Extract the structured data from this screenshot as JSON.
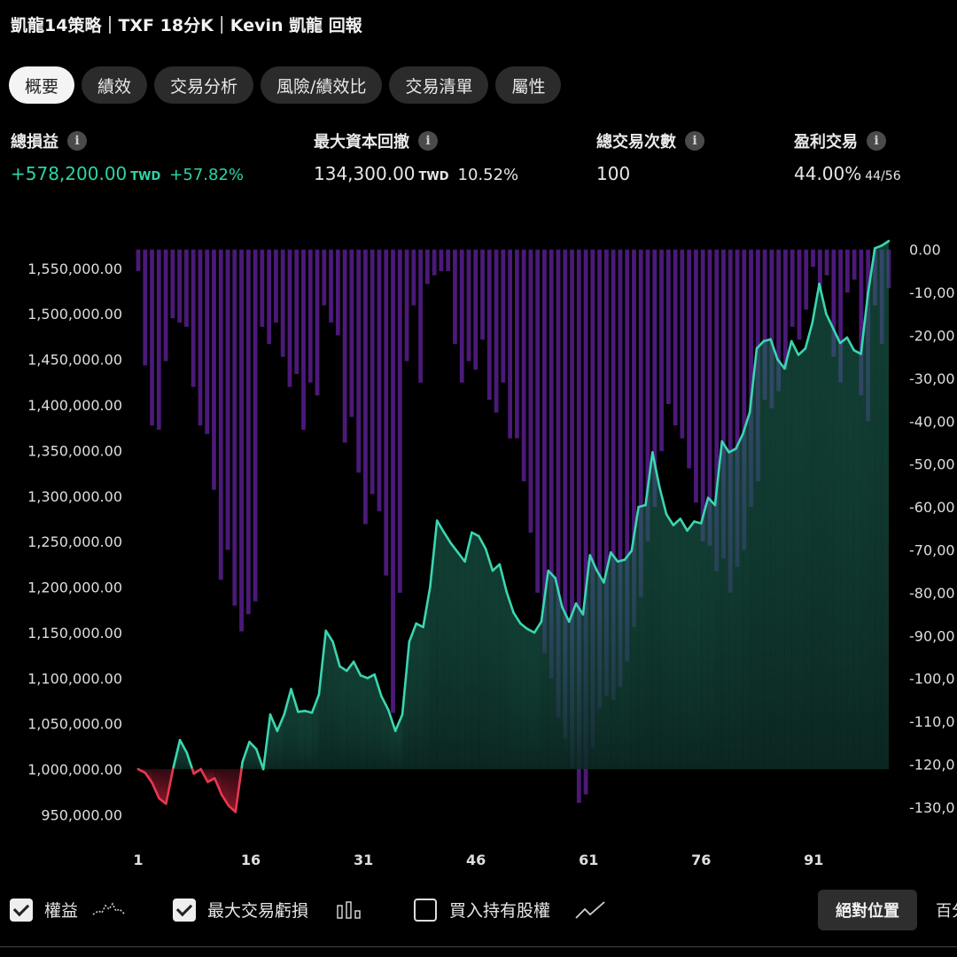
{
  "header": {
    "title": "凱龍14策略｜TXF 18分K｜Kevin 凱龍 回報"
  },
  "tabs": [
    {
      "label": "概要",
      "active": true
    },
    {
      "label": "績效"
    },
    {
      "label": "交易分析"
    },
    {
      "label": "風險/績效比"
    },
    {
      "label": "交易清單"
    },
    {
      "label": "屬性"
    }
  ],
  "stats": {
    "net_profit": {
      "label": "總損益",
      "value": "+578,200.00",
      "unit": "TWD",
      "pct": "+57.82%"
    },
    "max_drawdown": {
      "label": "最大資本回撤",
      "value": "134,300.00",
      "unit": "TWD",
      "pct": "10.52%"
    },
    "total_trades": {
      "label": "總交易次數",
      "value": "100"
    },
    "win_trades": {
      "label": "盈利交易",
      "value": "44.00%",
      "ratio": "44/56"
    }
  },
  "chart_data": {
    "type": "line",
    "x": [
      1,
      2,
      3,
      4,
      5,
      6,
      7,
      8,
      9,
      10,
      11,
      12,
      13,
      14,
      15,
      16,
      17,
      18,
      19,
      20,
      21,
      22,
      23,
      24,
      25,
      26,
      27,
      28,
      29,
      30,
      31,
      32,
      33,
      34,
      35,
      36,
      37,
      38,
      39,
      40,
      41,
      42,
      43,
      44,
      45,
      46,
      47,
      48,
      49,
      50,
      51,
      52,
      53,
      54,
      55,
      56,
      57,
      58,
      59,
      60,
      61,
      62,
      63,
      64,
      65,
      66,
      67,
      68,
      69,
      70,
      71,
      72,
      73,
      74,
      75,
      76,
      77,
      78,
      79,
      80,
      81,
      82,
      83,
      84,
      85,
      86,
      87,
      88,
      89,
      90,
      91,
      92,
      93,
      94,
      95,
      96,
      97,
      98,
      99,
      100,
      101
    ],
    "x_ticks": [
      "1",
      "16",
      "31",
      "46",
      "61",
      "76",
      "91"
    ],
    "y_left_ticks": [
      "950,000.00",
      "1,000,000.00",
      "1,050,000.00",
      "1,100,000.00",
      "1,150,000.00",
      "1,200,000.00",
      "1,250,000.00",
      "1,300,000.00",
      "1,350,000.00",
      "1,400,000.00",
      "1,450,000.00",
      "1,500,000.00",
      "1,550,000.00"
    ],
    "y_right_ticks": [
      "0.00",
      "-10,00",
      "-20,00",
      "-30,00",
      "-40,00",
      "-50,00",
      "-60,00",
      "-70,00",
      "-80,00",
      "-90,00",
      "-100,0",
      "-110,0",
      "-120,0",
      "-130,0"
    ],
    "baseline": 1000000,
    "ylim": [
      930000,
      1580000
    ],
    "y2lim": [
      -136000,
      2000
    ],
    "series": [
      {
        "name": "權益",
        "color": "#3bd6b0",
        "negative_color": "#e8384f",
        "values": [
          1000000,
          996000,
          985000,
          968000,
          962000,
          1000000,
          1032000,
          1018000,
          995000,
          1000000,
          986000,
          990000,
          972000,
          960000,
          953000,
          1008000,
          1030000,
          1022000,
          1000000,
          1060000,
          1042000,
          1060000,
          1088000,
          1063000,
          1064000,
          1062000,
          1082000,
          1152000,
          1140000,
          1113000,
          1108000,
          1118000,
          1103000,
          1100000,
          1104000,
          1080000,
          1065000,
          1042000,
          1060000,
          1140000,
          1160000,
          1156000,
          1200000,
          1273000,
          1260000,
          1248000,
          1238000,
          1228000,
          1260000,
          1256000,
          1242000,
          1218000,
          1225000,
          1195000,
          1172000,
          1160000,
          1154000,
          1150000,
          1162000,
          1218000,
          1210000,
          1178000,
          1162000,
          1182000,
          1170000,
          1235000,
          1218000,
          1205000,
          1238000,
          1228000,
          1230000,
          1240000,
          1288000,
          1290000,
          1348000,
          1310000,
          1280000,
          1268000,
          1275000,
          1262000,
          1272000,
          1270000,
          1298000,
          1290000,
          1360000,
          1348000,
          1352000,
          1368000,
          1392000,
          1462000,
          1470000,
          1472000,
          1450000,
          1440000,
          1470000,
          1455000,
          1462000,
          1490000,
          1533000,
          1500000,
          1484000,
          1468000,
          1474000,
          1460000,
          1456000,
          1522000,
          1572000,
          1575000,
          1580000
        ]
      },
      {
        "name": "最大交易虧損",
        "color": "#4b1a78",
        "values": [
          -5000,
          -27000,
          -41000,
          -42000,
          -26000,
          -16000,
          -17000,
          -18000,
          -32000,
          -41000,
          -43000,
          -56000,
          -77000,
          -70000,
          -83000,
          -89000,
          -85000,
          -82000,
          -18000,
          -22000,
          -17000,
          -25000,
          -32000,
          -29000,
          -42000,
          -31000,
          -34000,
          -13000,
          -17000,
          -20000,
          -45000,
          -39000,
          -52000,
          -64000,
          -57000,
          -61000,
          -76000,
          -108000,
          -80000,
          -26000,
          -13000,
          -31000,
          -8000,
          -6000,
          -5000,
          -5000,
          -22000,
          -31000,
          -26000,
          -28000,
          -21000,
          -35000,
          -38000,
          -31000,
          -44000,
          -44000,
          -54000,
          -66000,
          -80000,
          -94000,
          -100000,
          -109000,
          -114000,
          -121000,
          -129000,
          -127000,
          -116000,
          -107000,
          -104000,
          -105000,
          -102000,
          -96000,
          -88000,
          -81000,
          -68000,
          -60000,
          -47000,
          -36000,
          -41000,
          -44000,
          -51000,
          -59000,
          -68000,
          -69000,
          -75000,
          -72000,
          -80000,
          -74000,
          -70000,
          -60000,
          -54000,
          -35000,
          -37000,
          -33000,
          -28000,
          -18000,
          -21000,
          -14000,
          -4000,
          -10000,
          -6000,
          -25000,
          -31000,
          -10000,
          -7000,
          -34000,
          -40000,
          -13000,
          -22000,
          -9000
        ]
      }
    ]
  },
  "legend": [
    {
      "label": "權益",
      "checked": true,
      "icon": "equity-line-icon"
    },
    {
      "label": "最大交易虧損",
      "checked": true,
      "icon": "bar-chart-icon"
    },
    {
      "label": "買入持有股權",
      "checked": false,
      "icon": "trend-line-icon"
    }
  ],
  "controls": {
    "absolute_label": "絕對位置",
    "percent_label": "百分比"
  }
}
